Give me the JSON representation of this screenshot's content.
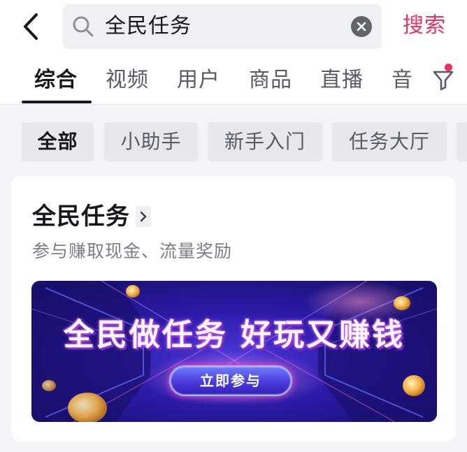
{
  "search": {
    "query": "全民任务",
    "submit_label": "搜索"
  },
  "tabs": [
    {
      "label": "综合",
      "active": true
    },
    {
      "label": "视频",
      "active": false
    },
    {
      "label": "用户",
      "active": false
    },
    {
      "label": "商品",
      "active": false
    },
    {
      "label": "直播",
      "active": false
    },
    {
      "label": "音",
      "active": false
    }
  ],
  "chips": [
    {
      "label": "全部",
      "active": true
    },
    {
      "label": "小助手",
      "active": false
    },
    {
      "label": "新手入门",
      "active": false
    },
    {
      "label": "任务大厅",
      "active": false
    }
  ],
  "card": {
    "title": "全民任务",
    "subtitle": "参与赚取现金、流量奖励",
    "banner": {
      "headline": "全民做任务 好玩又赚钱",
      "cta_label": "立即参与"
    }
  },
  "icons": {
    "back": "chevron-left-icon",
    "search": "search-icon",
    "clear": "clear-icon",
    "filter": "filter-icon",
    "title_arrow": "chevron-right-icon"
  },
  "colors": {
    "accent": "#f0325e",
    "text_primary": "#16181d",
    "text_secondary": "#585b63",
    "banner_base": "#2a1aa6"
  }
}
